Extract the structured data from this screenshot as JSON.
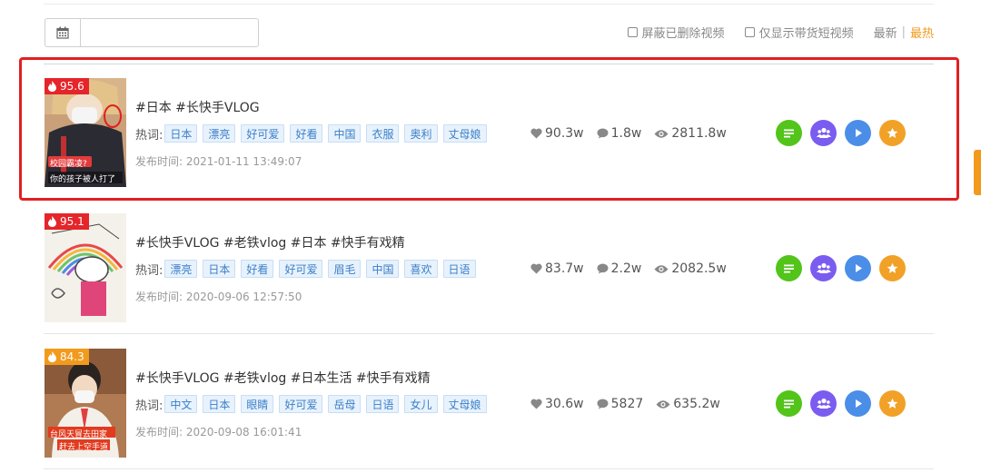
{
  "toolbar": {
    "date_value": "",
    "filter_hide_deleted": "屏蔽已删除视频",
    "filter_only_goods": "仅显示带货短视频",
    "sort_latest": "最新",
    "sort_separator": "|",
    "sort_hottest": "最热"
  },
  "labels": {
    "keywords": "热词:",
    "published": "发布时间:"
  },
  "colors": {
    "badge_red": "#e5252a",
    "badge_orange": "#f29a1c",
    "action_green": "#52c41a",
    "action_purple": "#7b5cf0",
    "action_blue": "#4a8ee8",
    "action_orange": "#f2a127",
    "highlight_border": "#e02020"
  },
  "action_icons": [
    "list-icon",
    "users-icon",
    "play-icon",
    "star-icon"
  ],
  "videos": [
    {
      "score": "95.6",
      "title": "#日本 #长快手VLOG",
      "tags": [
        "日本",
        "漂亮",
        "好可爱",
        "好看",
        "中国",
        "衣服",
        "奥利",
        "丈母娘"
      ],
      "published": "2021-01-11 13:49:07",
      "likes": "90.3w",
      "comments": "1.8w",
      "views": "2811.8w",
      "thumb_caption_1": "校园霸凌?",
      "thumb_caption_2": "你的孩子被人打了"
    },
    {
      "score": "95.1",
      "title": "#长快手VLOG #老铁vlog #日本 #快手有戏精",
      "tags": [
        "漂亮",
        "日本",
        "好看",
        "好可爱",
        "眉毛",
        "中国",
        "喜欢",
        "日语"
      ],
      "published": "2020-09-06 12:57:50",
      "likes": "83.7w",
      "comments": "2.2w",
      "views": "2082.5w"
    },
    {
      "score": "84.3",
      "title": "#长快手VLOG #老铁vlog #日本生活 #快手有戏精",
      "tags": [
        "中文",
        "日本",
        "眼睛",
        "好可爱",
        "岳母",
        "日语",
        "女儿",
        "丈母娘"
      ],
      "published": "2020-09-08 16:01:41",
      "likes": "30.6w",
      "comments": "5827",
      "views": "635.2w",
      "thumb_caption_1": "台风天冒去田家",
      "thumb_caption_2": "赶去上空手道"
    }
  ]
}
